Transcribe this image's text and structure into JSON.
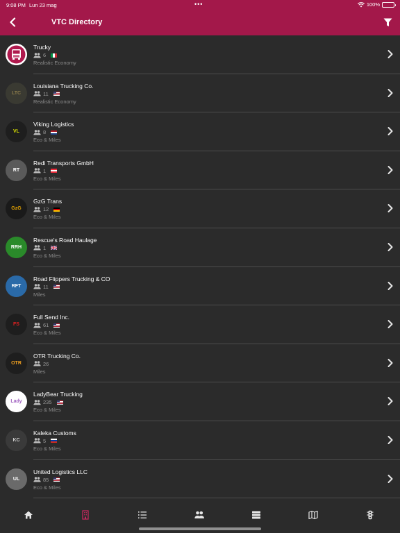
{
  "status": {
    "time": "9:08 PM",
    "date": "Lun 23 mag",
    "battery": "100%"
  },
  "header": {
    "title": "VTC Directory"
  },
  "vtcs": [
    {
      "name": "Trucky",
      "members": "6",
      "flag": "it",
      "game": "Realistic Economy",
      "logo_text": "",
      "logo_bg": "#ffffff",
      "logo_fg": "#b01a4e"
    },
    {
      "name": "Louisiana Trucking Co.",
      "members": "11",
      "flag": "us",
      "game": "Realistic Economy",
      "logo_text": "LTC",
      "logo_bg": "#3a3a32",
      "logo_fg": "#8a7a4a"
    },
    {
      "name": "Viking Logistics",
      "members": "8",
      "flag": "nl",
      "game": "Eco & Miles",
      "logo_text": "VL",
      "logo_bg": "#1e1e1e",
      "logo_fg": "#d8e000"
    },
    {
      "name": "Redi Transports GmbH",
      "members": "1",
      "flag": "at",
      "game": "Eco & Miles",
      "logo_text": "RT",
      "logo_bg": "#5a5a5a",
      "logo_fg": "#ffffff"
    },
    {
      "name": "GzG Trans",
      "members": "12",
      "flag": "de",
      "game": "Eco & Miles",
      "logo_text": "GzG",
      "logo_bg": "#1a1a1a",
      "logo_fg": "#e0a000"
    },
    {
      "name": "Rescue's Road Haulage",
      "members": "1",
      "flag": "gb",
      "game": "Eco & Miles",
      "logo_text": "RRH",
      "logo_bg": "#2a8a2a",
      "logo_fg": "#ffffff"
    },
    {
      "name": "Road Flippers Trucking & CO",
      "members": "11",
      "flag": "us",
      "game": "Miles",
      "logo_text": "RFT",
      "logo_bg": "#2a6aa8",
      "logo_fg": "#ffffff"
    },
    {
      "name": "Full Send Inc.",
      "members": "61",
      "flag": "us",
      "game": "Eco & Miles",
      "logo_text": "FS",
      "logo_bg": "#1e1e1e",
      "logo_fg": "#e02020"
    },
    {
      "name": "OTR Trucking Co.",
      "members": "26",
      "flag": "",
      "game": "Miles",
      "logo_text": "OTR",
      "logo_bg": "#1e1e1e",
      "logo_fg": "#f0a020"
    },
    {
      "name": "LadyBear Trucking",
      "members": "235",
      "flag": "us",
      "game": "Eco & Miles",
      "logo_text": "Lady",
      "logo_bg": "#ffffff",
      "logo_fg": "#a060c0"
    },
    {
      "name": "Kaleka Customs",
      "members": "5",
      "flag": "ru",
      "game": "Eco & Miles",
      "logo_text": "KC",
      "logo_bg": "#3a3a3a",
      "logo_fg": "#d0d0d0"
    },
    {
      "name": "United Logistics LLC",
      "members": "85",
      "flag": "us",
      "game": "Eco & Miles",
      "logo_text": "UL",
      "logo_bg": "#6a6a6a",
      "logo_fg": "#ffffff"
    }
  ],
  "tabs": [
    {
      "icon": "home-icon",
      "active": false
    },
    {
      "icon": "building-icon",
      "active": true
    },
    {
      "icon": "list-icon",
      "active": false
    },
    {
      "icon": "users-icon",
      "active": false
    },
    {
      "icon": "server-icon",
      "active": false
    },
    {
      "icon": "map-icon",
      "active": false
    },
    {
      "icon": "traffic-light-icon",
      "active": false
    }
  ],
  "colors": {
    "accent": "#a3184a",
    "background": "#2b2b2b",
    "divider": "#4d4d4d",
    "secondary_text": "#9a9a9a",
    "tab_active": "#c0285c",
    "tab_inactive": "#e6e6e6"
  }
}
